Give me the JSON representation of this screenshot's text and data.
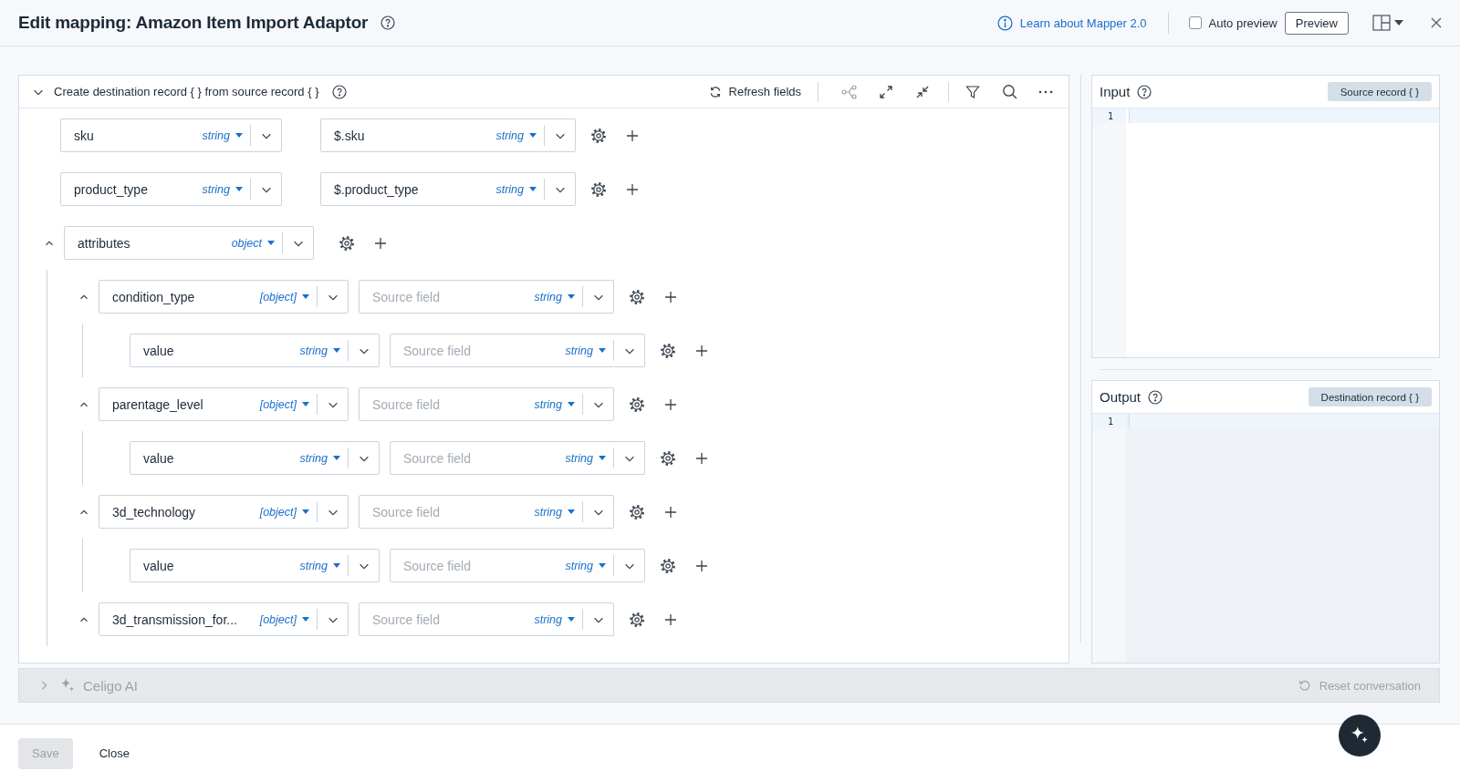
{
  "dialog": {
    "title": "Edit mapping: Amazon Item Import Adaptor",
    "learn_link": "Learn about Mapper 2.0",
    "auto_preview": {
      "label": "Auto preview",
      "checked": false
    },
    "preview_button": "Preview"
  },
  "mapper": {
    "header": "Create destination record { } from source record { }",
    "expanded": true,
    "refresh_button": "Refresh fields",
    "rows": [
      {
        "destination": "sku",
        "destination_type": "string",
        "source": "$.sku",
        "source_type": "string"
      },
      {
        "destination": "product_type",
        "destination_type": "string",
        "source": "$.product_type",
        "source_type": "string"
      },
      {
        "destination": "attributes",
        "destination_type": "object",
        "expanded": true,
        "children": [
          {
            "destination": "condition_type",
            "destination_type": "[object]",
            "source_placeholder": "Source field",
            "source_type": "string",
            "expanded": true,
            "children": [
              {
                "destination": "value",
                "destination_type": "string",
                "source_placeholder": "Source field",
                "source_type": "string"
              }
            ]
          },
          {
            "destination": "parentage_level",
            "destination_type": "[object]",
            "source_placeholder": "Source field",
            "source_type": "string",
            "expanded": true,
            "children": [
              {
                "destination": "value",
                "destination_type": "string",
                "source_placeholder": "Source field",
                "source_type": "string"
              }
            ]
          },
          {
            "destination": "3d_technology",
            "destination_type": "[object]",
            "source_placeholder": "Source field",
            "source_type": "string",
            "expanded": true,
            "children": [
              {
                "destination": "value",
                "destination_type": "string",
                "source_placeholder": "Source field",
                "source_type": "string"
              }
            ]
          },
          {
            "destination": "3d_transmission_for...",
            "destination_type": "[object]",
            "source_placeholder": "Source field",
            "source_type": "string",
            "expanded": true
          }
        ]
      }
    ]
  },
  "input_panel": {
    "title": "Input",
    "record_button": "Source record { }",
    "line_numbers": [
      "1"
    ]
  },
  "output_panel": {
    "title": "Output",
    "record_button": "Destination record { }",
    "line_numbers": [
      "1"
    ]
  },
  "ai_bar": {
    "label": "Celigo AI",
    "expanded": false,
    "reset_button": "Reset conversation"
  },
  "footer": {
    "save_button": {
      "label": "Save",
      "disabled": true
    },
    "close_button": "Close"
  }
}
